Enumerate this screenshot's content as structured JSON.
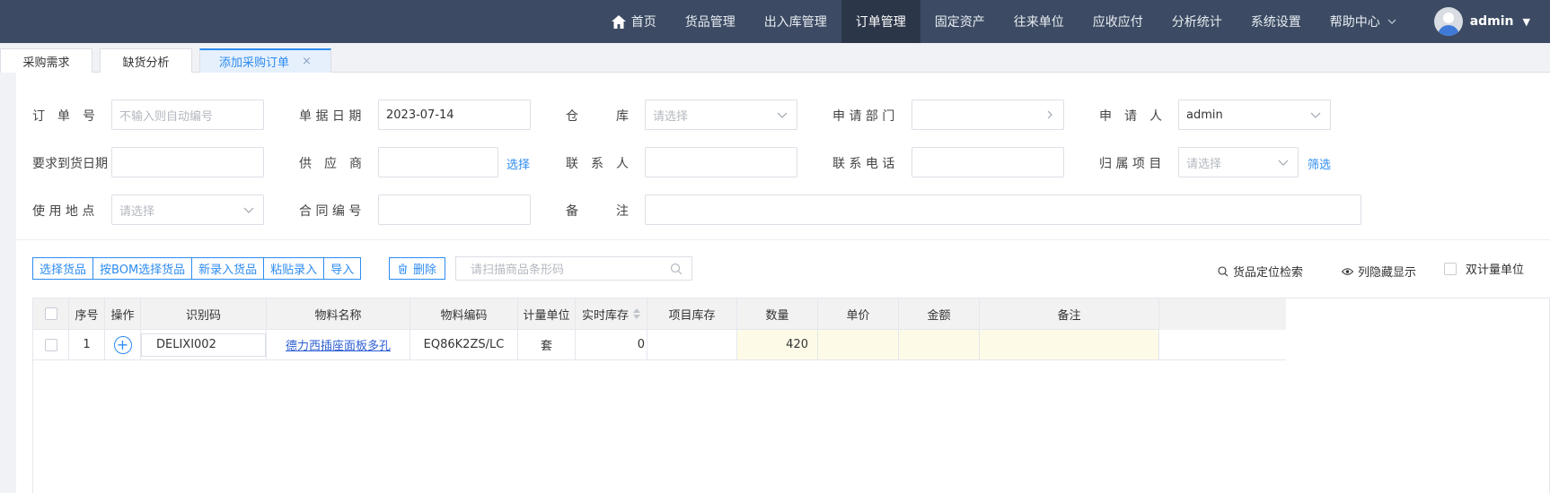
{
  "nav": {
    "items": [
      "首页",
      "货品管理",
      "出入库管理",
      "订单管理",
      "固定资产",
      "往来单位",
      "应收应付",
      "分析统计",
      "系统设置",
      "帮助中心"
    ],
    "active": "订单管理",
    "user": "admin"
  },
  "tabs": [
    {
      "label": "采购需求"
    },
    {
      "label": "缺货分析"
    },
    {
      "label": "添加采购订单",
      "close": "×"
    }
  ],
  "form": {
    "order_no": {
      "label": "订　单　号",
      "placeholder": "不输入则自动编号"
    },
    "doc_date": {
      "label": "单 据 日 期",
      "value": "2023-07-14"
    },
    "warehouse": {
      "label": "仓　　　库",
      "placeholder": "请选择"
    },
    "dept": {
      "label": "申 请 部 门",
      "value": ""
    },
    "applicant": {
      "label": "申　请　人",
      "value": "admin"
    },
    "arrival_date": {
      "label": "要求到货日期",
      "value": ""
    },
    "supplier": {
      "label": "供　应　商",
      "value": "",
      "link": "选择"
    },
    "contact": {
      "label": "联　系　人",
      "value": ""
    },
    "phone": {
      "label": "联 系 电 话",
      "value": ""
    },
    "project": {
      "label": "归 属 项 目",
      "placeholder": "请选择",
      "link": "筛选"
    },
    "location": {
      "label": "使 用 地 点",
      "placeholder": "请选择"
    },
    "contract_no": {
      "label": "合 同 编 号",
      "value": ""
    },
    "remark": {
      "label": "备　　　注",
      "value": ""
    }
  },
  "toolbar": {
    "buttons": [
      "选择货品",
      "按BOM选择货品",
      "新录入货品",
      "粘贴录入",
      "导入"
    ],
    "delete": "删除",
    "scan_placeholder": "请扫描商品条形码",
    "locate": "货品定位检索",
    "column_toggle": "列隐藏显示",
    "dual_unit": "双计量单位"
  },
  "table": {
    "headers": [
      "序号",
      "操作",
      "识别码",
      "物料名称",
      "物料编码",
      "计量单位",
      "实时库存",
      "项目库存",
      "数量",
      "单价",
      "金额",
      "备注"
    ],
    "rows": [
      {
        "seq": "1",
        "code": "DELIXI002",
        "name": "德力西插座面板多孔",
        "material_code": "EQ86K2ZS/LC",
        "unit": "套",
        "stock": "0",
        "project_stock": "",
        "qty": "420",
        "price": "",
        "amount": "",
        "remark": ""
      }
    ]
  }
}
